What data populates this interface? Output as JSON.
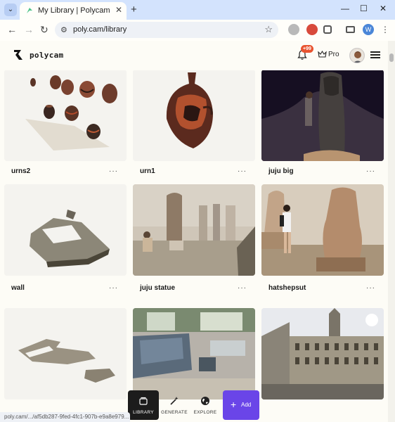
{
  "browser": {
    "tab_title": "My Library | Polycam",
    "new_tab_icon": "plus-icon",
    "url": "poly.cam/library",
    "profile_initial": "W",
    "status_url": "poly.cam/.../af5db287-9fed-4fc1-907b-e9a8e979..."
  },
  "app": {
    "brand": "polycam",
    "notification_count": "+99",
    "pro_label": "Pro"
  },
  "library": {
    "items": [
      {
        "name": "urns2",
        "more": "···"
      },
      {
        "name": "urn1",
        "more": "···"
      },
      {
        "name": "juju big",
        "more": "···"
      },
      {
        "name": "wall",
        "more": "···"
      },
      {
        "name": "juju statue",
        "more": "···"
      },
      {
        "name": "hatshepsut",
        "more": "···"
      },
      {
        "name": "",
        "more": ""
      },
      {
        "name": "",
        "more": ""
      },
      {
        "name": "",
        "more": ""
      }
    ]
  },
  "bottom_nav": {
    "library": "LIBRARY",
    "generate": "GENERATE",
    "explore": "EXPLORE",
    "add": "Add"
  },
  "colors": {
    "accent": "#6a45e8",
    "badge": "#e8532f",
    "page_bg": "#fdfcf6"
  }
}
